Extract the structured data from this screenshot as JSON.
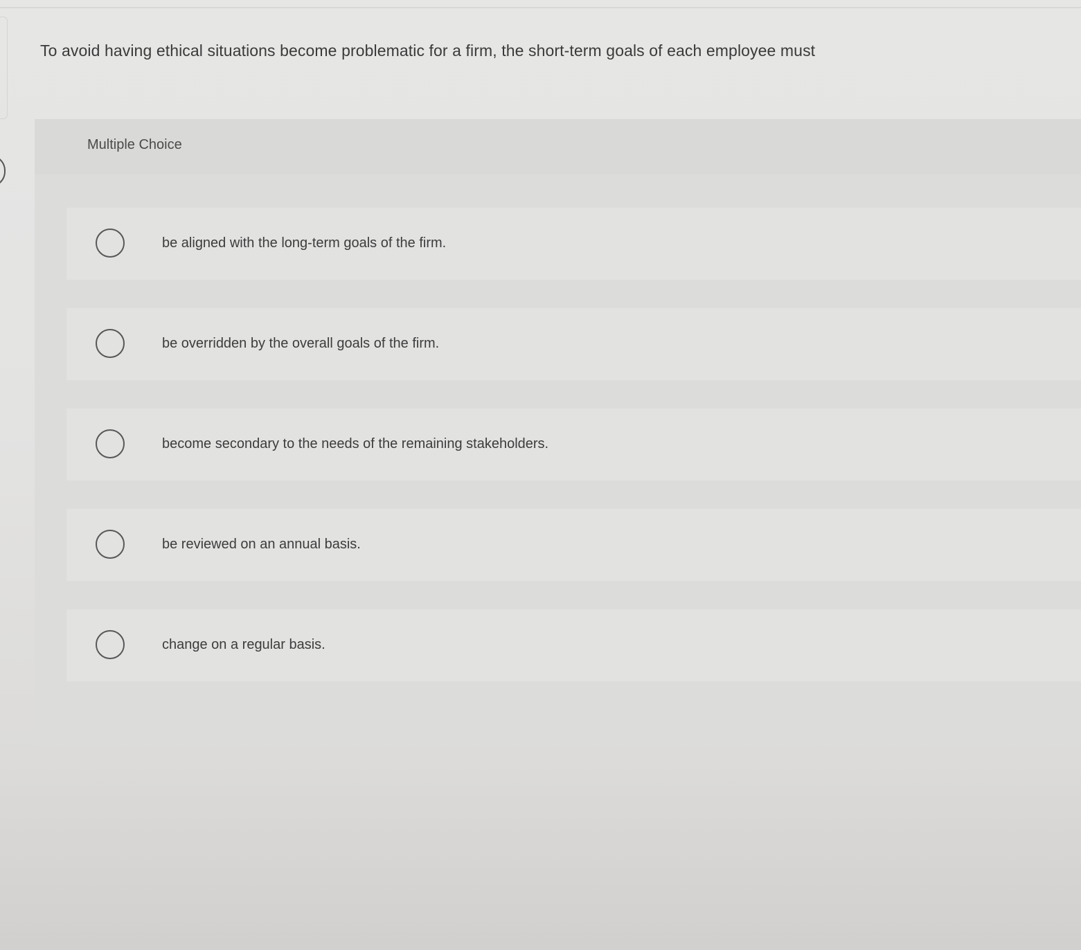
{
  "question": {
    "text": "To avoid having ethical situations become problematic for a firm, the short-term goals of each employee must"
  },
  "multiple_choice": {
    "label": "Multiple Choice",
    "options": [
      {
        "text": "be aligned with the long-term goals of the firm.",
        "selected": false
      },
      {
        "text": "be overridden by the overall goals of the firm.",
        "selected": false
      },
      {
        "text": "become secondary to the needs of the remaining stakeholders.",
        "selected": false
      },
      {
        "text": "be reviewed on an annual basis.",
        "selected": false
      },
      {
        "text": "change on a regular basis.",
        "selected": false
      }
    ]
  },
  "colors": {
    "page_background": "#e4e4e3",
    "card_background": "#dcdcdb",
    "option_background": "#e2e2e1",
    "text": "#3c3c3c",
    "radio_border": "#575757"
  }
}
